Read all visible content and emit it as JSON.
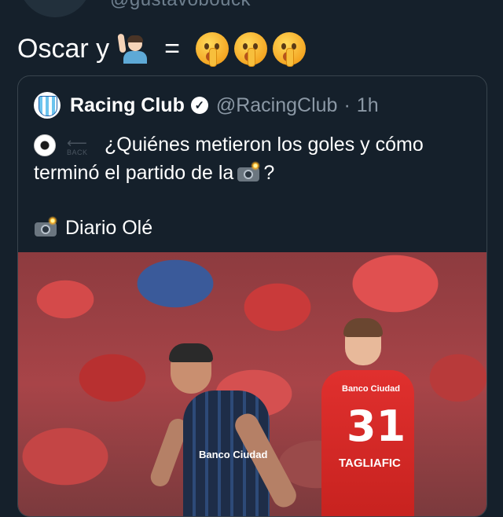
{
  "retweeter": {
    "handle": "@gustavobouck"
  },
  "tweet": {
    "text_before": "Oscar y",
    "emoji_man_icon": "man-raising-hand-icon",
    "equals": "=",
    "shush_icon": "shushing-face-icon",
    "shush_count": 3
  },
  "quoted": {
    "name": "Racing Club",
    "handle": "@RacingClub",
    "separator": "·",
    "time": "1h",
    "verified_icon": "verified-badge-icon",
    "avatar_icon": "racing-club-logo-icon",
    "line1_text": "¿Quiénes metieron los goles y cómo",
    "line2_text": "terminó el partido de la",
    "line2_suffix": "?",
    "back_icon_label": "BACK",
    "line4_text": "Diario Olé",
    "image": {
      "left_player_sponsor": "Banco Ciudad",
      "right_player_sponsor": "Banco Ciudad",
      "right_player_number": "31",
      "right_player_name": "TAGLIAFIC"
    }
  },
  "colors": {
    "background": "#15202b",
    "border": "#38444d",
    "muted_text": "#8b98a5",
    "text": "#ffffff"
  }
}
